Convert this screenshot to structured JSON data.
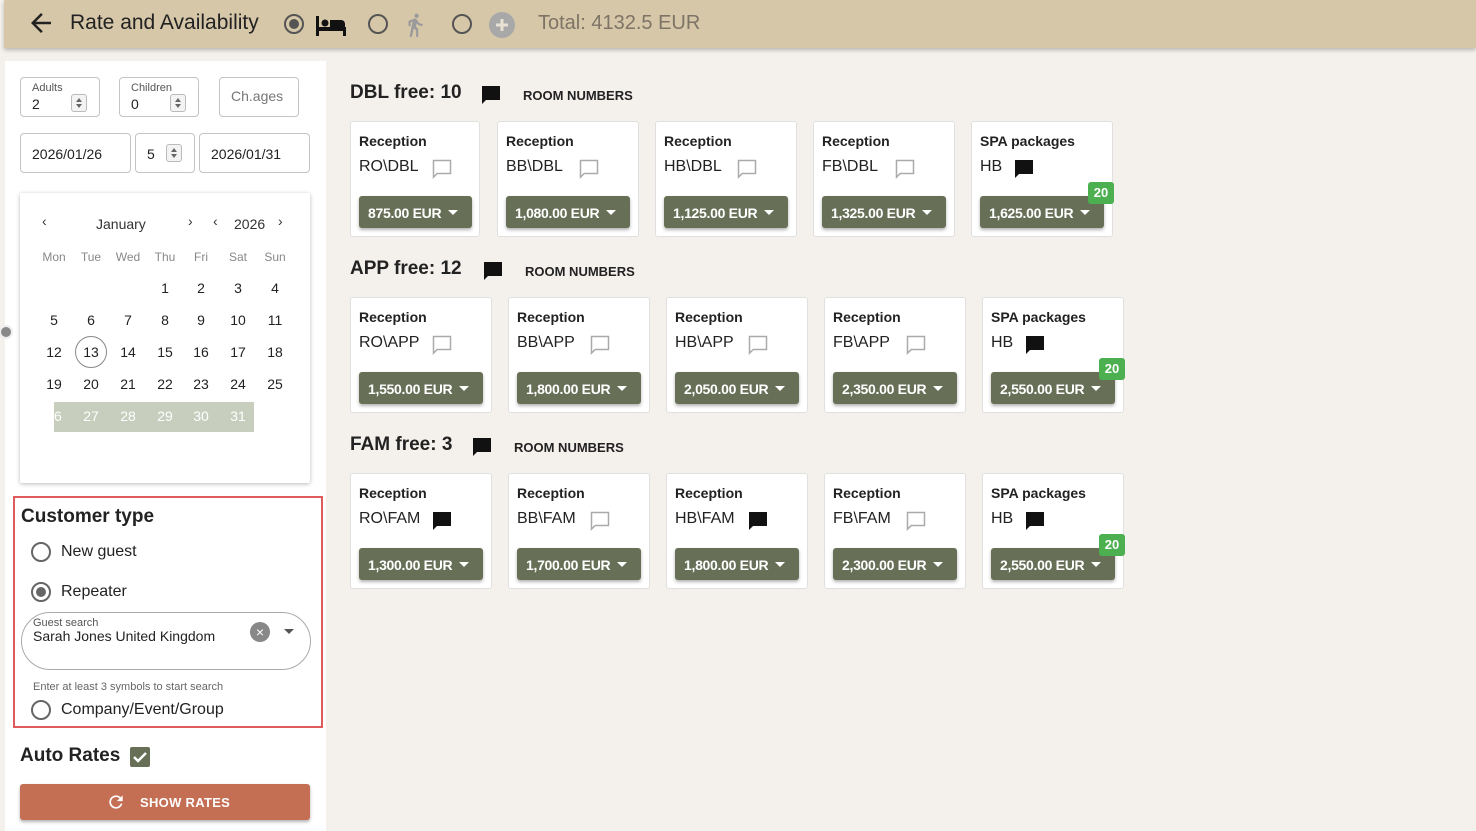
{
  "header": {
    "title": "Rate and Availability",
    "total": "Total: 4132.5 EUR"
  },
  "form": {
    "adults_label": "Adults",
    "adults_value": "2",
    "children_label": "Children",
    "children_value": "0",
    "chages_placeholder": "Ch.ages",
    "date_from": "2026/01/26",
    "nights": "5",
    "date_to": "2026/01/31"
  },
  "calendar": {
    "month": "January",
    "year": "2026",
    "weekdays": [
      "Mon",
      "Tue",
      "Wed",
      "Thu",
      "Fri",
      "Sat",
      "Sun"
    ]
  },
  "customer": {
    "title": "Customer type",
    "opt_new": "New guest",
    "opt_repeater": "Repeater",
    "search_label": "Guest search",
    "search_value": "Sarah Jones United Kingdom",
    "hint": "Enter at least 3 symbols to start search",
    "opt_company": "Company/Event/Group"
  },
  "auto_rates_label": "Auto Rates",
  "show_rates_label": "SHOW RATES",
  "room_numbers_label": "ROOM NUMBERS",
  "sections": [
    {
      "title": "DBL free: 10",
      "cards": [
        {
          "source": "Reception",
          "code": "RO\\DBL",
          "price": "875.00 EUR"
        },
        {
          "source": "Reception",
          "code": "BB\\DBL",
          "price": "1,080.00 EUR"
        },
        {
          "source": "Reception",
          "code": "HB\\DBL",
          "price": "1,125.00 EUR"
        },
        {
          "source": "Reception",
          "code": "FB\\DBL",
          "price": "1,325.00 EUR"
        },
        {
          "source": "SPA packages",
          "code": "HB",
          "price": "1,625.00 EUR",
          "badge": "20"
        }
      ]
    },
    {
      "title": "APP free: 12",
      "cards": [
        {
          "source": "Reception",
          "code": "RO\\APP",
          "price": "1,550.00 EUR"
        },
        {
          "source": "Reception",
          "code": "BB\\APP",
          "price": "1,800.00 EUR"
        },
        {
          "source": "Reception",
          "code": "HB\\APP",
          "price": "2,050.00 EUR"
        },
        {
          "source": "Reception",
          "code": "FB\\APP",
          "price": "2,350.00 EUR"
        },
        {
          "source": "SPA packages",
          "code": "HB",
          "price": "2,550.00 EUR",
          "badge": "20"
        }
      ]
    },
    {
      "title": "FAM free: 3",
      "cards": [
        {
          "source": "Reception",
          "code": "RO\\FAM",
          "price": "1,300.00 EUR"
        },
        {
          "source": "Reception",
          "code": "BB\\FAM",
          "price": "1,700.00 EUR"
        },
        {
          "source": "Reception",
          "code": "HB\\FAM",
          "price": "1,800.00 EUR"
        },
        {
          "source": "Reception",
          "code": "FB\\FAM",
          "price": "2,300.00 EUR"
        },
        {
          "source": "SPA packages",
          "code": "HB",
          "price": "2,550.00 EUR",
          "badge": "20"
        }
      ]
    }
  ]
}
